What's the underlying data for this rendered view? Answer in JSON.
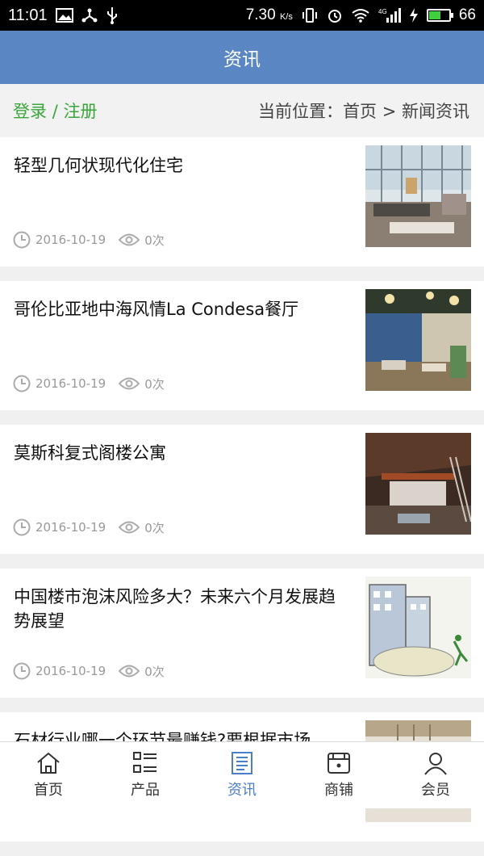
{
  "status_bar": {
    "time": "11:01",
    "speed": "7.30",
    "speed_unit": "K/s",
    "network": "4G",
    "battery": "66",
    "battery_level": 0.66
  },
  "header": {
    "title": "资讯"
  },
  "breadcrumb": {
    "login": "登录",
    "separator": "/",
    "register": "注册",
    "location": "当前位置：首页 > 新闻资讯"
  },
  "news": [
    {
      "title": "轻型几何状现代化住宅",
      "date": "2016-10-19",
      "views": "0次"
    },
    {
      "title": "哥伦比亚地中海风情La Condesa餐厅",
      "date": "2016-10-19",
      "views": "0次"
    },
    {
      "title": "莫斯科复式阁楼公寓",
      "date": "2016-10-19",
      "views": "0次"
    },
    {
      "title": "中国楼市泡沫风险多大？未来六个月发展趋势展望",
      "date": "2016-10-19",
      "views": "0次"
    },
    {
      "title": "石材行业哪一个环节最赚钱?要根据市场",
      "date": "",
      "views": ""
    }
  ],
  "nav": [
    {
      "label": "首页",
      "icon": "home-icon"
    },
    {
      "label": "产品",
      "icon": "product-list-icon"
    },
    {
      "label": "资讯",
      "icon": "news-icon",
      "active": true
    },
    {
      "label": "商铺",
      "icon": "shop-icon"
    },
    {
      "label": "会员",
      "icon": "member-icon"
    }
  ],
  "colors": {
    "header_bg": "#5a87c4",
    "login_green": "#3aa53a",
    "nav_active": "#4a7fc8"
  }
}
